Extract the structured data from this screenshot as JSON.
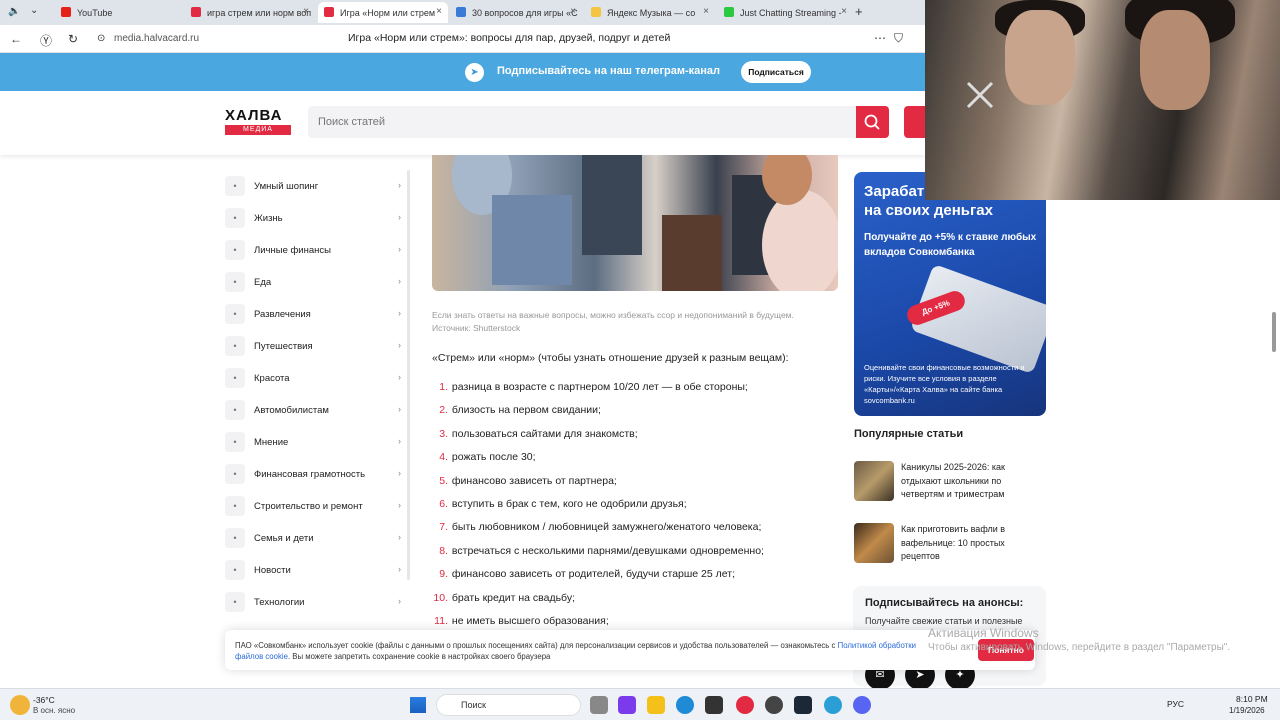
{
  "browser": {
    "tabs": [
      {
        "label": "YouTube",
        "color": "#e62117"
      },
      {
        "label": "игра стрем или норм воп",
        "color": "#e22a42"
      },
      {
        "label": "Игра «Норм или стрем",
        "color": "#e22a42"
      },
      {
        "label": "30 вопросов для игры «С",
        "color": "#3a7bd5"
      },
      {
        "label": "Яндекс Музыка — со",
        "color": "#f5c542"
      },
      {
        "label": "Just Chatting Streaming -",
        "color": "#2ac940"
      }
    ],
    "url": "media.halvacard.ru",
    "page_title": "Игра «Норм или стрем»: вопросы для пар, друзей, подруг и детей"
  },
  "telegram": {
    "text": "Подписывайтесь на наш телеграм-канал",
    "button": "Подписаться"
  },
  "header": {
    "logo": "ХАЛВА",
    "logo_sub": "МЕДИА",
    "search_placeholder": "Поиск статей"
  },
  "sidebar": [
    {
      "label": "Умный шопинг",
      "icon": "cart-icon"
    },
    {
      "label": "Жизнь",
      "icon": "pulse-icon"
    },
    {
      "label": "Личные финансы",
      "icon": "wallet-icon"
    },
    {
      "label": "Еда",
      "icon": "fork-icon"
    },
    {
      "label": "Развлечения",
      "icon": "party-icon"
    },
    {
      "label": "Путешествия",
      "icon": "plane-icon"
    },
    {
      "label": "Красота",
      "icon": "beauty-icon"
    },
    {
      "label": "Автомобилистам",
      "icon": "car-icon"
    },
    {
      "label": "Мнение",
      "icon": "chat-icon"
    },
    {
      "label": "Финансовая грамотность",
      "icon": "card-icon"
    },
    {
      "label": "Строительство и ремонт",
      "icon": "tools-icon"
    },
    {
      "label": "Семья и дети",
      "icon": "stroller-icon"
    },
    {
      "label": "Новости",
      "icon": "news-icon"
    },
    {
      "label": "Технологии",
      "icon": "phone-icon"
    }
  ],
  "article": {
    "caption": "Если знать ответы на важные вопросы, можно избежать ссор и недопониманий в будущем. Источник: Shutterstock",
    "intro": "«Стрем» или «норм» (чтобы узнать отношение друзей к разным вещам):",
    "items": [
      "разница в возрасте с партнером 10/20 лет — в обе стороны;",
      "близость на первом свидании;",
      "пользоваться сайтами для знакомств;",
      "рожать после 30;",
      "финансово зависеть от партнера;",
      "вступить в брак с тем, кого не одобрили друзья;",
      "быть любовником / любовницей замужнего/женатого человека;",
      "встречаться с несколькими парнями/девушками одновременно;",
      "финансово зависеть от родителей, будучи старше 25 лет;",
      "брать кредит на свадьбу;",
      "не иметь высшего образования;"
    ]
  },
  "ad": {
    "heading1": "Зарабатывайте",
    "heading2": "на своих деньгах",
    "text": "Получайте до +5% к ставке любых вкладов Совкомбанка",
    "pill": "До +5%",
    "small": "Оценивайте свои финансовые возможности и риски. Изучите все условия в разделе «Карты»/«Карта Халва» на сайте банка sovcombank.ru"
  },
  "popular": {
    "title": "Популярные статьи",
    "items": [
      "Каникулы 2025-2026: как отдыхают школьники по четвертям и триместрам",
      "Как приготовить вафли в вафельнице: 10 простых рецептов"
    ]
  },
  "subscribe": {
    "title": "Подписывайтесь на анонсы:",
    "text": "Получайте свежие статьи и полезные"
  },
  "cookie": {
    "text": "ПАО «Совкомбанк» использует cookie (файлы с данными о прошлых посещениях сайта) для персонализации сервисов и удобства пользователей — ознакомьтесь с ",
    "link1": "Политикой обработки",
    "link2": "файлов cookie",
    "text2": ". Вы можете запретить сохранение cookie в настройках своего браузера",
    "button": "Понятно"
  },
  "watermark": {
    "line1": "Активация Windows",
    "line2": "Чтобы активировать Windows, перейдите в раздел \"Параметры\"."
  },
  "taskbar": {
    "temp": "-36°C",
    "weather": "В осн. ясно",
    "search": "Поиск",
    "lang": "РУС",
    "time": "8:10 PM",
    "date": "1/19/2026"
  }
}
